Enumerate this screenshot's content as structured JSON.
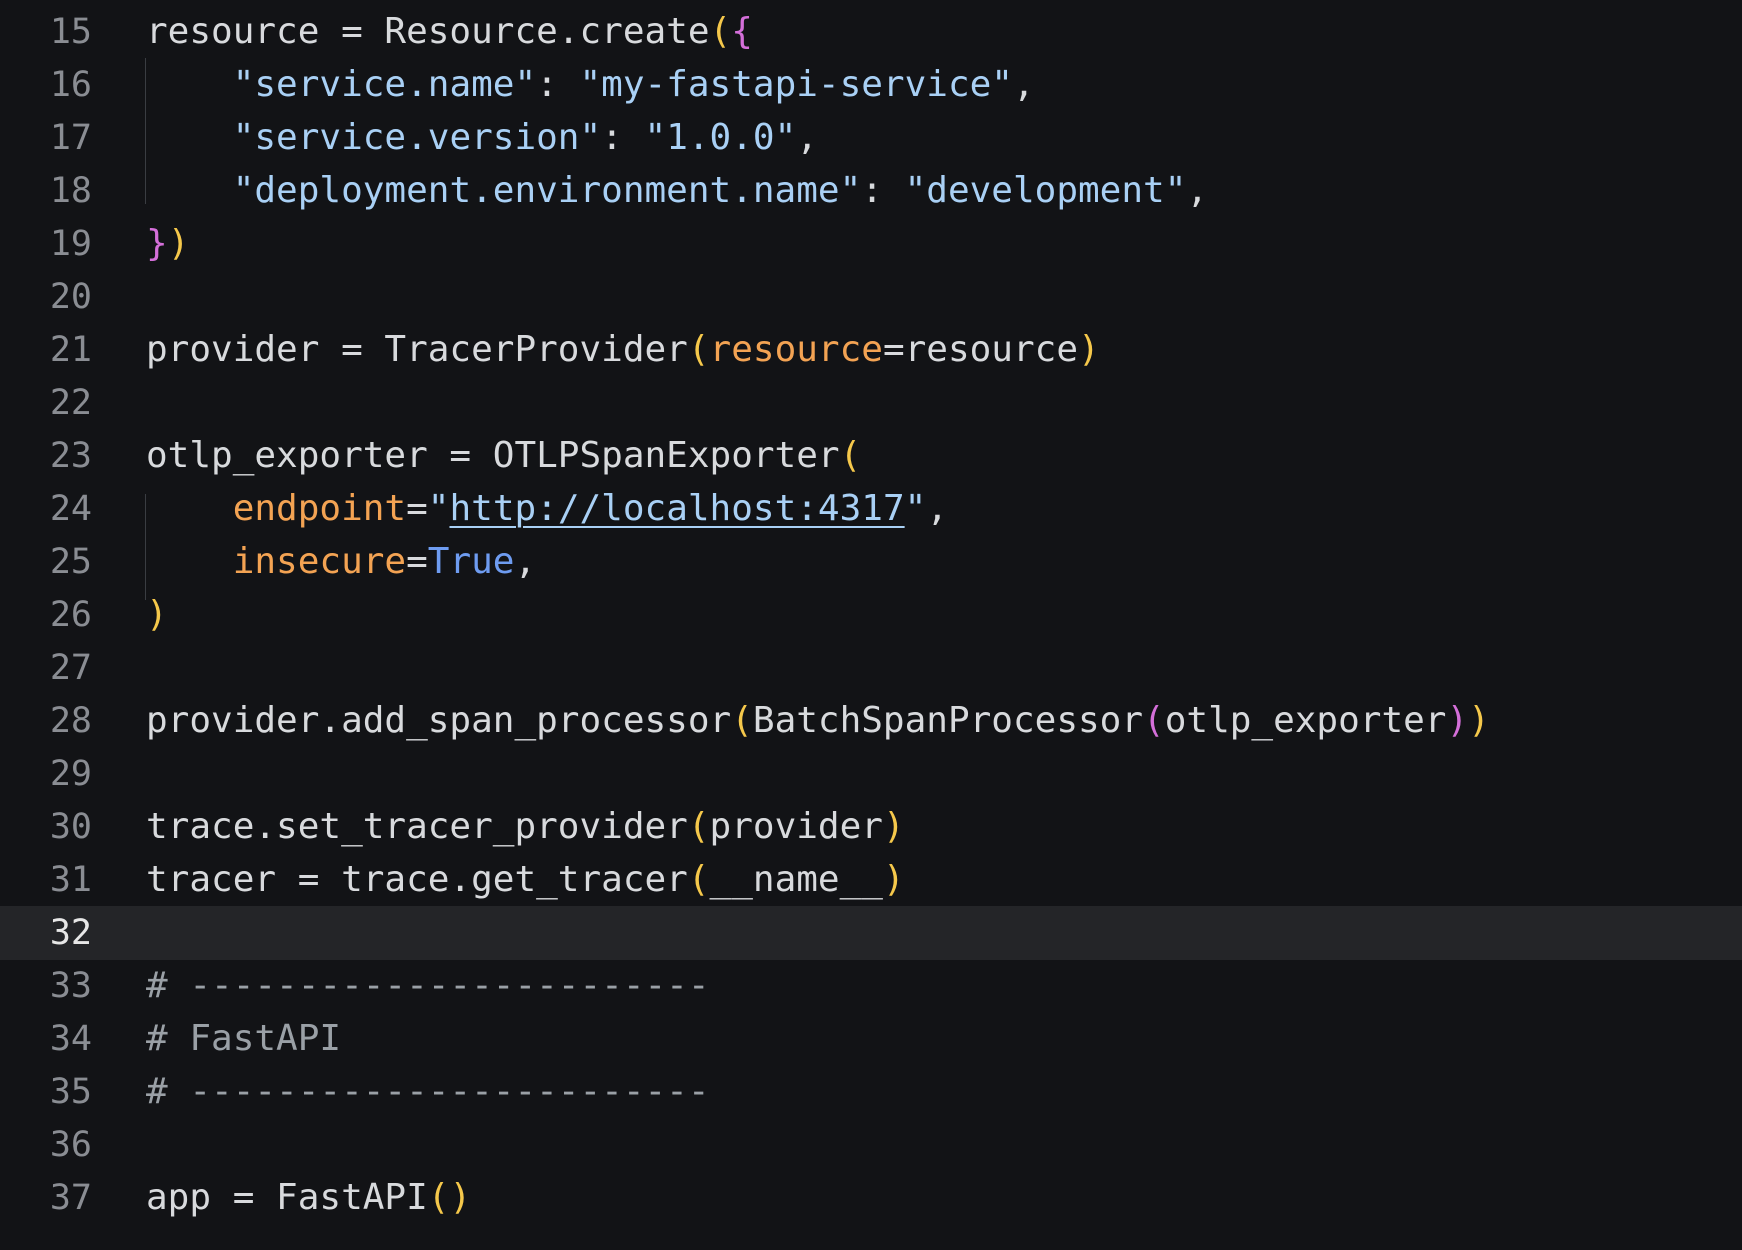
{
  "editor": {
    "current_line": "32",
    "lines": [
      {
        "number": "15",
        "tokens": [
          {
            "text": "resource = Resource.create",
            "type": "punc"
          },
          {
            "text": "(",
            "type": "b1"
          },
          {
            "text": "{",
            "type": "b2"
          }
        ]
      },
      {
        "number": "16",
        "tokens": [
          {
            "text": "    ",
            "type": "punc"
          },
          {
            "text": "\"service.name\"",
            "type": "string"
          },
          {
            "text": ": ",
            "type": "punc"
          },
          {
            "text": "\"my-fastapi-service\"",
            "type": "string"
          },
          {
            "text": ",",
            "type": "punc"
          }
        ]
      },
      {
        "number": "17",
        "tokens": [
          {
            "text": "    ",
            "type": "punc"
          },
          {
            "text": "\"service.version\"",
            "type": "string"
          },
          {
            "text": ": ",
            "type": "punc"
          },
          {
            "text": "\"1.0.0\"",
            "type": "string"
          },
          {
            "text": ",",
            "type": "punc"
          }
        ]
      },
      {
        "number": "18",
        "tokens": [
          {
            "text": "    ",
            "type": "punc"
          },
          {
            "text": "\"deployment.environment.name\"",
            "type": "string"
          },
          {
            "text": ": ",
            "type": "punc"
          },
          {
            "text": "\"development\"",
            "type": "string"
          },
          {
            "text": ",",
            "type": "punc"
          }
        ]
      },
      {
        "number": "19",
        "tokens": [
          {
            "text": "}",
            "type": "b2"
          },
          {
            "text": ")",
            "type": "b1"
          }
        ]
      },
      {
        "number": "20",
        "tokens": []
      },
      {
        "number": "21",
        "tokens": [
          {
            "text": "provider = TracerProvider",
            "type": "punc"
          },
          {
            "text": "(",
            "type": "b1"
          },
          {
            "text": "resource",
            "type": "param"
          },
          {
            "text": "=resource",
            "type": "punc"
          },
          {
            "text": ")",
            "type": "b1"
          }
        ]
      },
      {
        "number": "22",
        "tokens": []
      },
      {
        "number": "23",
        "tokens": [
          {
            "text": "otlp_exporter = OTLPSpanExporter",
            "type": "punc"
          },
          {
            "text": "(",
            "type": "b1"
          }
        ]
      },
      {
        "number": "24",
        "tokens": [
          {
            "text": "    ",
            "type": "punc"
          },
          {
            "text": "endpoint",
            "type": "param"
          },
          {
            "text": "=",
            "type": "punc"
          },
          {
            "text": "\"",
            "type": "string"
          },
          {
            "text": "http://localhost:4317",
            "type": "link"
          },
          {
            "text": "\"",
            "type": "string"
          },
          {
            "text": ",",
            "type": "punc"
          }
        ]
      },
      {
        "number": "25",
        "tokens": [
          {
            "text": "    ",
            "type": "punc"
          },
          {
            "text": "insecure",
            "type": "param"
          },
          {
            "text": "=",
            "type": "punc"
          },
          {
            "text": "True",
            "type": "keyword"
          },
          {
            "text": ",",
            "type": "punc"
          }
        ]
      },
      {
        "number": "26",
        "tokens": [
          {
            "text": ")",
            "type": "b1"
          }
        ]
      },
      {
        "number": "27",
        "tokens": []
      },
      {
        "number": "28",
        "tokens": [
          {
            "text": "provider.add_span_processor",
            "type": "punc"
          },
          {
            "text": "(",
            "type": "b1"
          },
          {
            "text": "BatchSpanProcessor",
            "type": "punc"
          },
          {
            "text": "(",
            "type": "b2"
          },
          {
            "text": "otlp_exporter",
            "type": "punc"
          },
          {
            "text": ")",
            "type": "b2"
          },
          {
            "text": ")",
            "type": "b1"
          }
        ]
      },
      {
        "number": "29",
        "tokens": []
      },
      {
        "number": "30",
        "tokens": [
          {
            "text": "trace.set_tracer_provider",
            "type": "punc"
          },
          {
            "text": "(",
            "type": "b1"
          },
          {
            "text": "provider",
            "type": "punc"
          },
          {
            "text": ")",
            "type": "b1"
          }
        ]
      },
      {
        "number": "31",
        "tokens": [
          {
            "text": "tracer = trace.get_tracer",
            "type": "punc"
          },
          {
            "text": "(",
            "type": "b1"
          },
          {
            "text": "__name__",
            "type": "punc"
          },
          {
            "text": ")",
            "type": "b1"
          }
        ]
      },
      {
        "number": "32",
        "tokens": []
      },
      {
        "number": "33",
        "tokens": [
          {
            "text": "# ------------------------",
            "type": "comment"
          }
        ]
      },
      {
        "number": "34",
        "tokens": [
          {
            "text": "# FastAPI",
            "type": "comment"
          }
        ]
      },
      {
        "number": "35",
        "tokens": [
          {
            "text": "# ------------------------",
            "type": "comment"
          }
        ]
      },
      {
        "number": "36",
        "tokens": []
      },
      {
        "number": "37",
        "tokens": [
          {
            "text": "app = FastAPI",
            "type": "punc"
          },
          {
            "text": "()",
            "type": "b1"
          }
        ]
      }
    ]
  },
  "colors": {
    "background": "#121316",
    "current_line_background": "#242528",
    "text": "#d8dadd",
    "string": "#a9d0f5",
    "parameter": "#f3a353",
    "keyword": "#6e9cf1",
    "comment": "#9aa0a6",
    "bracket_level_1": "#f5c84b",
    "bracket_level_2": "#d46fd9"
  }
}
